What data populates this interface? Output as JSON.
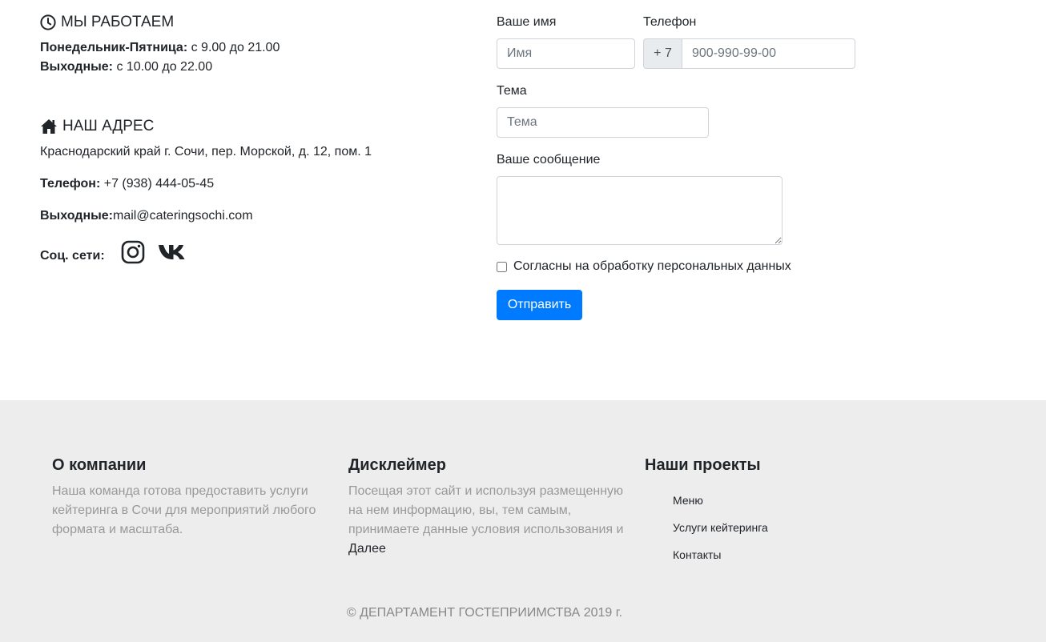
{
  "hours": {
    "icon": "clock-icon",
    "title": "МЫ РАБОТАЕМ",
    "weekdays_label": "Понедельник-Пятница:",
    "weekdays_value": " с 9.00 до 21.00",
    "weekend_label": "Выходные:",
    "weekend_value": " с 10.00 до 22.00"
  },
  "address": {
    "icon": "home-icon",
    "title": "НАШ АДРЕС",
    "line": "Краснодарский край г. Сочи, пер. Морской, д. 12, пом. 1",
    "phone_label": "Телефон:",
    "phone_value": " +7 (938) 444-05-45",
    "email_label": "Выходные:",
    "email_value": "mail@cateringsochi.com",
    "social_label": "Соц. сети:"
  },
  "form": {
    "name_label": "Ваше имя",
    "name_placeholder": "Имя",
    "phone_label": "Телефон",
    "phone_prefix": "+ 7",
    "phone_placeholder": "900-990-99-00",
    "subject_label": "Тема",
    "subject_placeholder": "Тема",
    "message_label": "Ваше сообщение",
    "consent_label": "Согласны на обработку персональных данных",
    "submit_label": "Отправить"
  },
  "footer": {
    "about_title": "О компании",
    "about_text": "Наша команда готова предоставить услуги кейтеринга в Сочи для мероприятий любого формата и масштаба.",
    "disclaimer_title": "Дисклеймер",
    "disclaimer_text": "Посещая этот сайт и используя размещенную на нем информацию, вы, тем самым, принимаете данные условия использования и",
    "disclaimer_more": "Далее",
    "projects_title": "Наши проекты",
    "projects": [
      "Меню",
      "Услуги кейтеринга",
      "Контакты"
    ],
    "copyright": "© ДЕПАРТАМЕНТ ГОСТЕПРИИМСТВА 2019 г."
  },
  "colors": {
    "primary": "#007bff",
    "footer_bg": "#ededed",
    "muted_text": "#999999"
  }
}
